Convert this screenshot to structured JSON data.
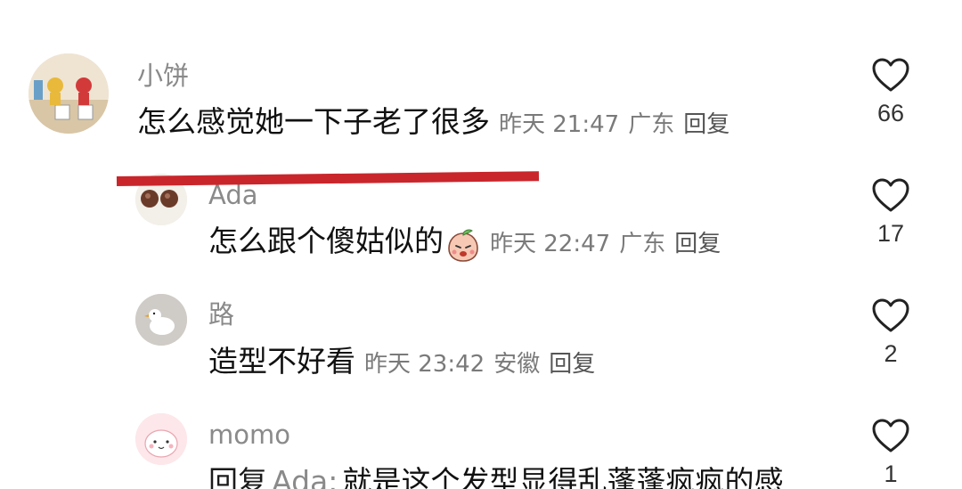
{
  "comments": [
    {
      "username": "小饼",
      "text": "怎么感觉她一下子老了很多",
      "time": "昨天 21:47",
      "location": "广东",
      "reply_label": "回复",
      "likes": "66"
    },
    {
      "username": "Ada",
      "text": "怎么跟个傻姑似的",
      "time": "昨天 22:47",
      "location": "广东",
      "reply_label": "回复",
      "likes": "17"
    },
    {
      "username": "路",
      "text": "造型不好看",
      "time": "昨天 23:42",
      "location": "安徽",
      "reply_label": "回复",
      "likes": "2"
    },
    {
      "username": "momo",
      "reply_prefix": "回复",
      "reply_to": "Ada:",
      "text": "就是这个发型显得乱蓬蓬疯疯的感",
      "likes": "1"
    }
  ],
  "colors": {
    "annotation_line": "#c9262c",
    "username": "#8a8a8a",
    "meta": "#7a7a7a"
  }
}
